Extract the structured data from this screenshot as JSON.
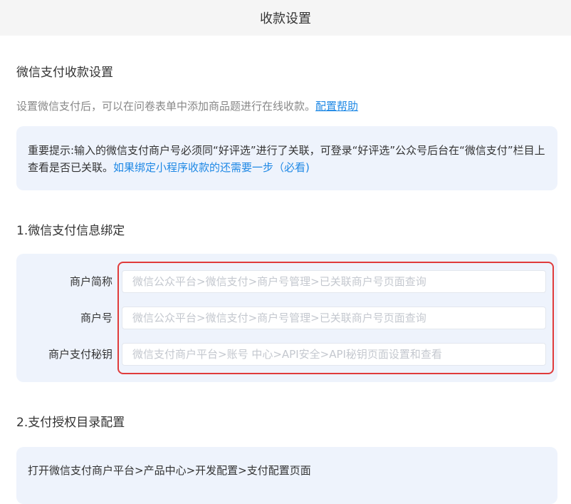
{
  "header": {
    "title": "收款设置"
  },
  "section": {
    "title": "微信支付收款设置",
    "description": "设置微信支付后，可以在问卷表单中添加商品题进行在线收款。",
    "help_link": "配置帮助"
  },
  "notice": {
    "text": "重要提示:输入的微信支付商户号必须同“好评选”进行了关联，可登录“好评选”公众号后台在“微信支付”栏目上查看是否已关联。",
    "link": "如果绑定小程序收款的还需要一步（必看)"
  },
  "binding": {
    "title": "1.微信支付信息绑定",
    "fields": [
      {
        "label": "商户简称",
        "value": "",
        "placeholder": "微信公众平台>微信支付>商户号管理>已关联商户号页面查询"
      },
      {
        "label": "商户号",
        "value": "",
        "placeholder": "微信公众平台>微信支付>商户号管理>已关联商户号页面查询"
      },
      {
        "label": "商户支付秘钥",
        "value": "",
        "placeholder": "微信支付商户平台>账号 中心>API安全>API秘钥页面设置和查看"
      }
    ]
  },
  "auth": {
    "title": "2.支付授权目录配置",
    "step_text": "打开微信支付商户平台>产品中心>开发配置>支付配置页面"
  },
  "colors": {
    "accent": "#1e88e5",
    "panel_bg": "#eef3fc",
    "highlight_border": "#e03b3b"
  }
}
